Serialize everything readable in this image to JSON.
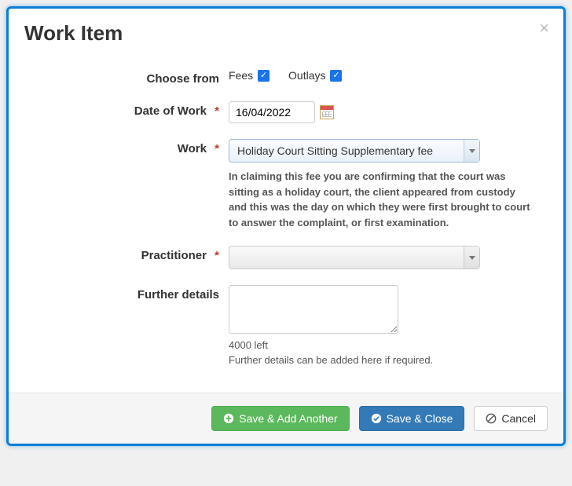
{
  "modal": {
    "title": "Work Item",
    "close_label": "×"
  },
  "form": {
    "choose_from": {
      "label": "Choose from",
      "options": [
        {
          "label": "Fees",
          "checked": true
        },
        {
          "label": "Outlays",
          "checked": true
        }
      ]
    },
    "date_of_work": {
      "label": "Date of Work",
      "required_mark": "*",
      "value": "16/04/2022"
    },
    "work": {
      "label": "Work",
      "required_mark": "*",
      "selected": "Holiday Court Sitting Supplementary fee",
      "hint": "In claiming this fee you are confirming that the court was sitting as a holiday court, the client appeared from custody and this was the day on which they were first brought to court to answer the complaint, or first examination."
    },
    "practitioner": {
      "label": "Practitioner",
      "required_mark": "*",
      "selected": ""
    },
    "further_details": {
      "label": "Further details",
      "value": "",
      "counter": "4000 left",
      "helper": "Further details can be added here if required."
    }
  },
  "footer": {
    "save_add_another": "Save & Add Another",
    "save_close": "Save & Close",
    "cancel": "Cancel"
  }
}
